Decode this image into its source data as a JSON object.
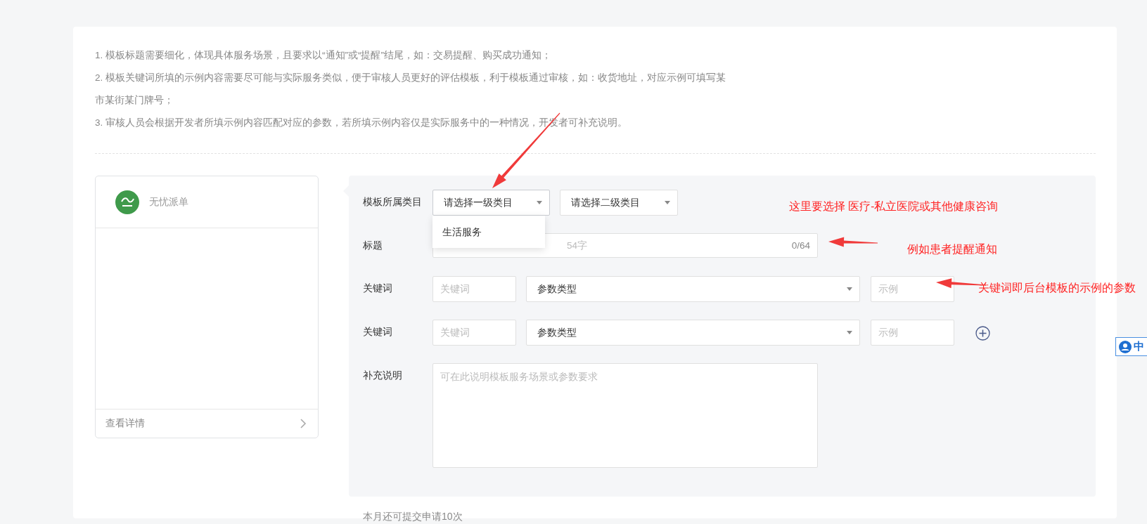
{
  "notes": [
    "1. 模板标题需要细化，体现具体服务场景，且要求以“通知”或“提醒”结尾，如：交易提醒、购买成功通知；",
    "2. 模板关键词所填的示例内容需要尽可能与实际服务类似，便于审核人员更好的评估模板，利于模板通过审核，如：收货地址，对应示例可填写某",
    "市某街某门牌号；",
    "3. 审核人员会根据开发者所填示例内容匹配对应的参数，若所填示例内容仅是实际服务中的一种情况，开发者可补充说明。"
  ],
  "preview": {
    "account_name": "无忧派单",
    "footer_link": "查看详情"
  },
  "form": {
    "category": {
      "label": "模板所属类目",
      "primary": {
        "value": "请选择一级类目",
        "expanded": true,
        "options": [
          "生活服务"
        ]
      },
      "secondary": {
        "value": "请选择二级类目"
      }
    },
    "title": {
      "label": "标题",
      "placeholder": "54字",
      "counter": "0/64"
    },
    "keywords": [
      {
        "label": "关键词",
        "keyword_placeholder": "关键词",
        "type_value": "参数类型",
        "example_placeholder": "示例"
      },
      {
        "label": "关键词",
        "keyword_placeholder": "关键词",
        "type_value": "参数类型",
        "example_placeholder": "示例"
      }
    ],
    "supplement": {
      "label": "补充说明",
      "placeholder": "可在此说明模板服务场景或参数要求"
    }
  },
  "quota_text": "本月还可提交申请10次",
  "annotations": [
    {
      "text": "这里要选择 医疗-私立医院或其他健康咨询"
    },
    {
      "text": "例如患者提醒通知"
    },
    {
      "text": "关键词即后台模板的示例的参数"
    }
  ],
  "ime_badge": "中"
}
